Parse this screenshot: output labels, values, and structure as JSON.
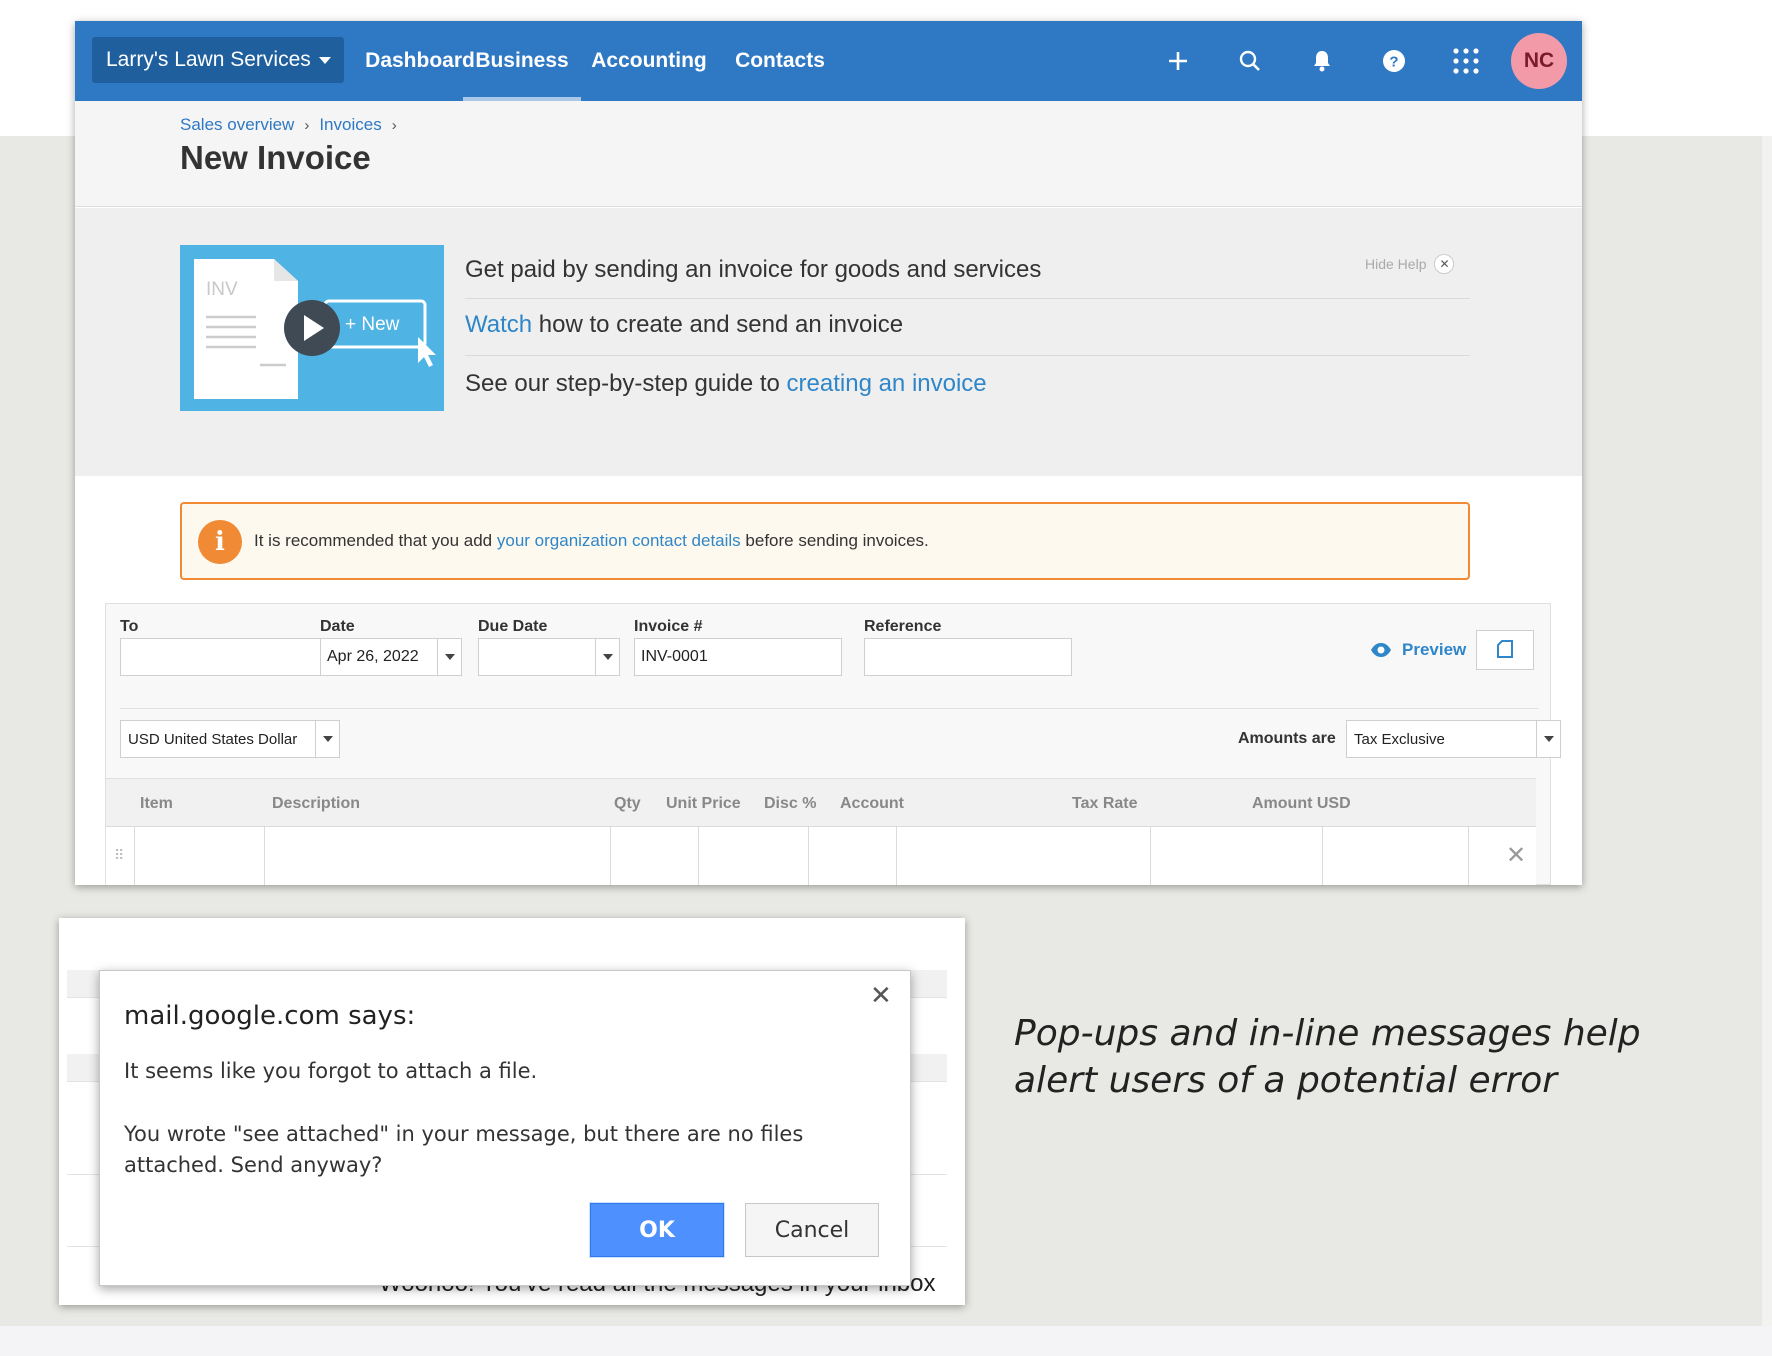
{
  "colors": {
    "brand_blue": "#2f78c4",
    "org_switch_bg": "#1f5f9e",
    "link_blue": "#2f86c9",
    "alert_orange": "#f08a34",
    "avatar_pink": "#f39aa9",
    "help_thumb_blue": "#4fb3e3",
    "dialog_ok_blue": "#4d90fe"
  },
  "topbar": {
    "org_name": "Larry's Lawn Services",
    "nav": [
      "Dashboard",
      "Business",
      "Accounting",
      "Contacts"
    ],
    "active_nav": "Business",
    "icons": [
      "plus-icon",
      "search-icon",
      "bell-icon",
      "help-icon",
      "apps-grid-icon"
    ],
    "avatar_initials": "NC"
  },
  "breadcrumb": [
    "Sales overview",
    "Invoices"
  ],
  "page_title": "New Invoice",
  "help": {
    "hide_label": "Hide Help",
    "thumb_doc_label": "INV",
    "thumb_new_label": "+ New",
    "line1": "Get paid by sending an invoice for goods and services",
    "line2_link": "Watch",
    "line2_rest": " how to create and send an invoice",
    "line3_text": "See our step-by-step guide to ",
    "line3_link": "creating an invoice"
  },
  "alert": {
    "pre": "It is recommended that you add ",
    "link": "your organization contact details",
    "post": " before sending invoices."
  },
  "form": {
    "to_label": "To",
    "to_value": "",
    "date_label": "Date",
    "date_value": "Apr 26, 2022",
    "due_label": "Due Date",
    "due_value": "",
    "invoice_label": "Invoice #",
    "invoice_value": "INV-0001",
    "reference_label": "Reference",
    "reference_value": "",
    "preview_label": "Preview",
    "currency_value": "USD United States Dollar",
    "amounts_are_label": "Amounts are",
    "tax_mode_value": "Tax Exclusive"
  },
  "table": {
    "columns": [
      "Item",
      "Description",
      "Qty",
      "Unit Price",
      "Disc %",
      "Account",
      "Tax Rate",
      "Amount USD"
    ]
  },
  "dialog": {
    "title": "mail.google.com says:",
    "message1": "It seems like you forgot to attach a file.",
    "message2": "You wrote \"see attached\" in your message, but there are no files attached. Send anyway?",
    "ok_label": "OK",
    "cancel_label": "Cancel",
    "background_peek_text": "Woohoo! You've read all the messages in your inbox"
  },
  "caption": "Pop-ups and in-line messages help alert users of a potential error"
}
